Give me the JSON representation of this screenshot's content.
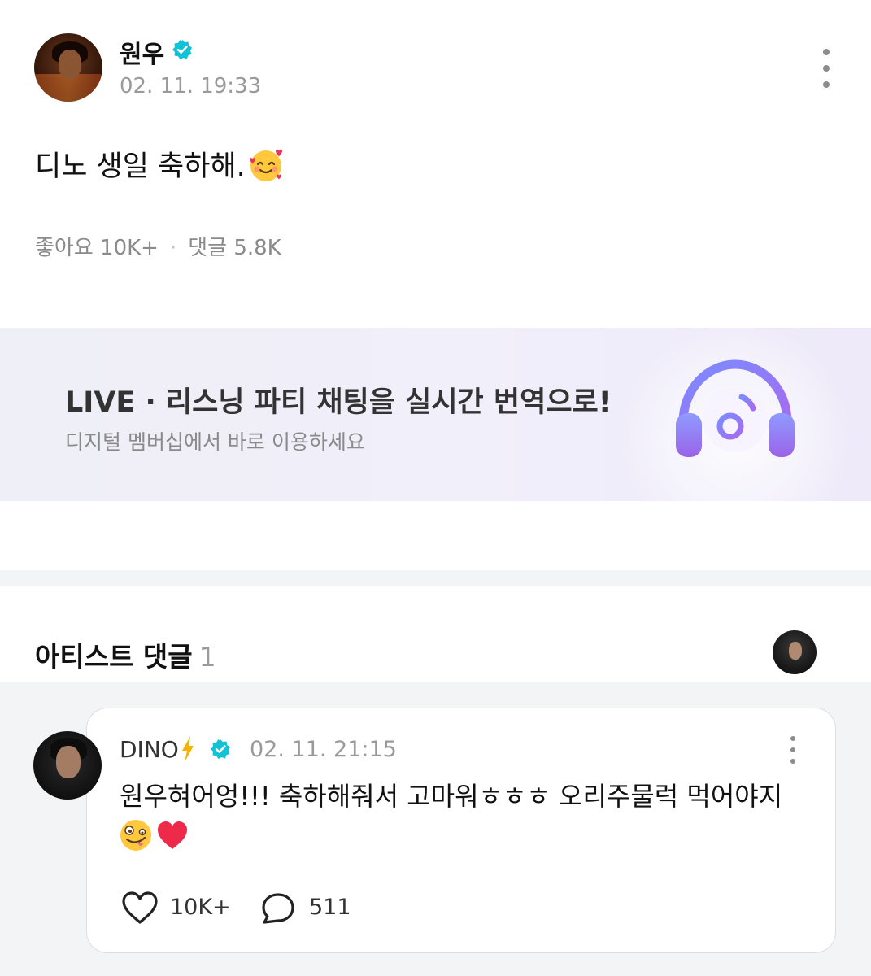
{
  "post": {
    "author": "원우",
    "timestamp": "02. 11. 19:33",
    "text": "디노 생일 축하해.",
    "text_emoji": "smiling-face-with-hearts",
    "likes_label": "좋아요",
    "likes_count": "10K+",
    "comments_label": "댓글",
    "comments_count": "5.8K"
  },
  "banner": {
    "title": "LIVE · 리스닝 파티 채팅을 실시간 번역으로!",
    "subtitle": "디지털 멤버십에서 바로 이용하세요",
    "icon": "headphone-music-icon"
  },
  "artist_comments": {
    "title": "아티스트 댓글",
    "count": "1",
    "comment": {
      "author": "DINO",
      "author_badge": "lightning",
      "timestamp": "02. 11. 21:15",
      "text": "원우혀어엉!!! 축하해줘서 고마워ㅎㅎㅎ 오리주물럭 먹어야지",
      "emojis": [
        "zany-face",
        "red-heart"
      ],
      "likes": "10K+",
      "replies": "511"
    }
  },
  "colors": {
    "verified": "#12c2d6",
    "muted_text": "#9a9a9a",
    "banner_bg": "#efeff7",
    "icon_purple": "#8e6cf2",
    "lightning": "#f4b400"
  }
}
